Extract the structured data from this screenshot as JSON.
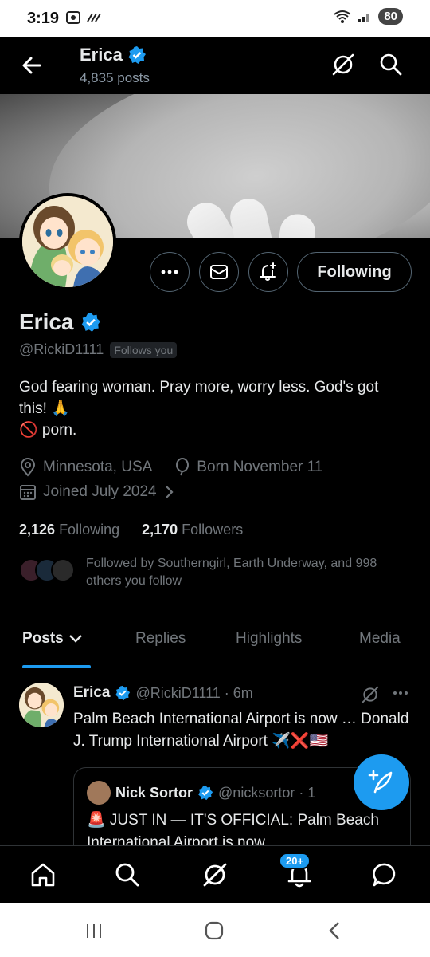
{
  "status_bar": {
    "time": "3:19",
    "battery": "80"
  },
  "header": {
    "name": "Erica",
    "posts": "4,835 posts"
  },
  "profile": {
    "name": "Erica",
    "handle": "@RickiD1111",
    "follows_you": "Follows you",
    "bio_line1": "God fearing woman. Pray more, worry less. God's got this! 🙏",
    "bio_line2": "🚫 porn.",
    "location": "Minnesota, USA",
    "birthday": "Born November 11",
    "joined": "Joined July 2024",
    "following_count": "2,126",
    "following_label": "Following",
    "followers_count": "2,170",
    "followers_label": "Followers",
    "followed_by": "Followed by Southerngirl, Earth Underway, and 998 others you follow"
  },
  "actions": {
    "following_button": "Following"
  },
  "tabs": [
    {
      "label": "Posts"
    },
    {
      "label": "Replies"
    },
    {
      "label": "Highlights"
    },
    {
      "label": "Media"
    }
  ],
  "tweet": {
    "name": "Erica",
    "handle": "@RickiD1111 · 6m",
    "text": "Palm Beach International Airport is now … Donald J. Trump International Airport ✈️❌🇺🇸",
    "quote": {
      "name": "Nick Sortor",
      "handle": "@nicksortor · 1",
      "text": "🚨 JUST IN — IT'S OFFICIAL: Palm Beach International Airport is now"
    }
  },
  "nav": {
    "notifications_badge": "20+"
  },
  "colors": {
    "accent": "#1d9bf0",
    "background": "#000000",
    "secondary_text": "#71767b"
  }
}
